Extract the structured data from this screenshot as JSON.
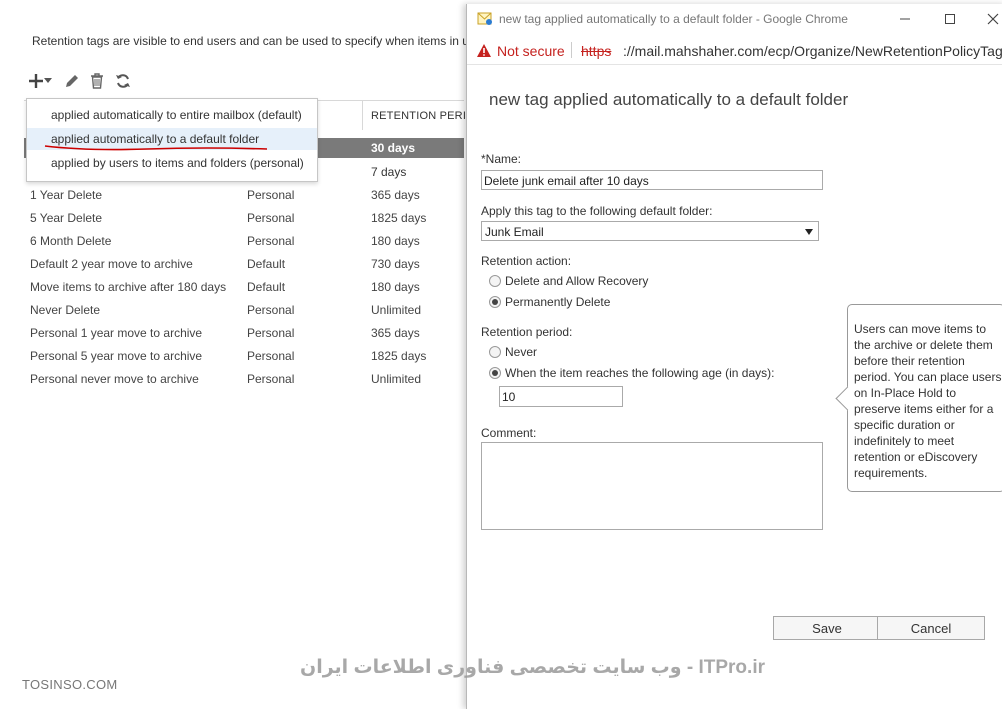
{
  "page": {
    "intro_text": "Retention tags are visible to end users and can be used to specify when items in u",
    "toolbar": {
      "add_icon": "plus-icon",
      "dropdown_icon": "caret-down-icon",
      "edit_icon": "pencil-icon",
      "delete_icon": "trash-icon",
      "refresh_icon": "refresh-icon"
    },
    "grid": {
      "retention_header": "RETENTION PERIOD",
      "selected_retention": "30 days",
      "row_partial_retention": "7 days",
      "rows": [
        {
          "name": "1 Year Delete",
          "type": "Personal",
          "retention": "365 days"
        },
        {
          "name": "5 Year Delete",
          "type": "Personal",
          "retention": "1825 days"
        },
        {
          "name": "6 Month Delete",
          "type": "Personal",
          "retention": "180 days"
        },
        {
          "name": "Default 2 year move to archive",
          "type": "Default",
          "retention": "730 days"
        },
        {
          "name": "Move items to archive after 180 days",
          "type": "Default",
          "retention": "180 days"
        },
        {
          "name": "Never Delete",
          "type": "Personal",
          "retention": "Unlimited"
        },
        {
          "name": "Personal 1 year move to archive",
          "type": "Personal",
          "retention": "365 days"
        },
        {
          "name": "Personal 5 year move to archive",
          "type": "Personal",
          "retention": "1825 days"
        },
        {
          "name": "Personal never move to archive",
          "type": "Personal",
          "retention": "Unlimited"
        }
      ]
    },
    "menu": {
      "items": [
        "applied automatically to entire mailbox (default)",
        "applied automatically to a default folder",
        "applied by users to items and folders (personal)"
      ],
      "highlight_color": "#e6f0fa",
      "underline_color": "#cc0000"
    }
  },
  "browser": {
    "title": "new tag applied automatically to a default folder - Google Chrome",
    "minimize_icon": "minimize-icon",
    "maximize_icon": "maximize-icon",
    "close_icon": "close-icon",
    "security_label": "Not secure",
    "scheme": "https",
    "url_rest": "://mail.mahshaher.com/ecp/Organize/NewRetentionPolicyTag.a"
  },
  "form": {
    "title": "new tag applied automatically to a default folder",
    "name_label": "*Name:",
    "name_value": "Delete junk email after 10 days",
    "folder_label": "Apply this tag to the following default folder:",
    "folder_value": "Junk Email",
    "action_label": "Retention action:",
    "action_options": [
      "Delete and Allow Recovery",
      "Permanently Delete"
    ],
    "action_selected": 1,
    "period_label": "Retention period:",
    "period_options": [
      "Never",
      "When the item reaches the following age (in days):"
    ],
    "period_selected": 1,
    "age_value": "10",
    "comment_label": "Comment:",
    "comment_value": "",
    "save_label": "Save",
    "cancel_label": "Cancel",
    "help_text": "Users can move items to the archive or delete them before their retention period. You can place users on In-Place Hold to preserve items either for a specific duration or indefinitely to meet retention or eDiscovery requirements."
  },
  "watermarks": {
    "persian": "ITPro.ir - وب سایت تخصصی فناوری اطلاعات ایران",
    "site": "TOSINSO.COM"
  }
}
